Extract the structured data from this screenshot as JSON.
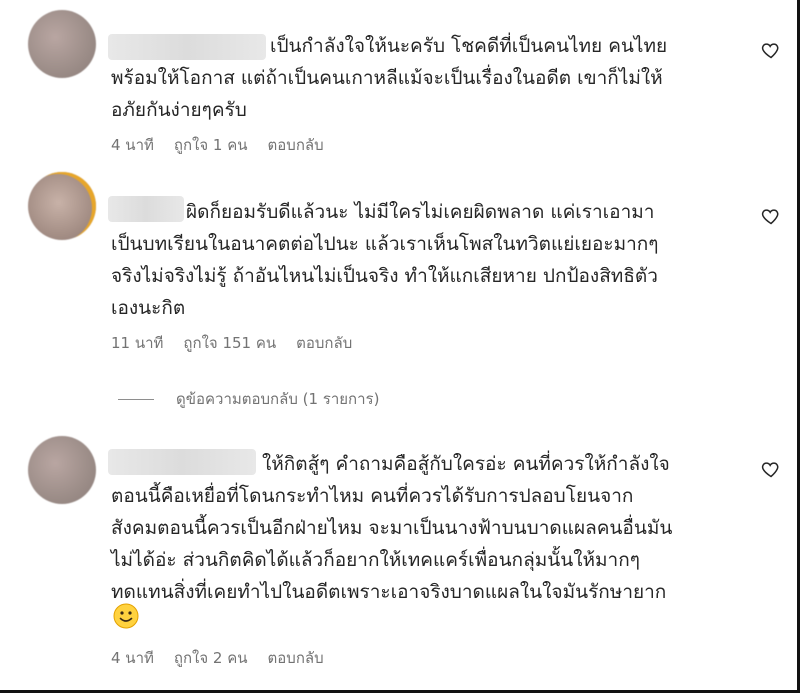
{
  "comments": [
    {
      "text_lines": [
        "เป็นกำลังใจให้นะครับ โชคดีที่เป็นคนไทย คนไทย",
        "พร้อมให้โอกาส แต่ถ้าเป็นคนเกาหลีแม้จะเป็นเรื่องในอดีต เขาก็ไม่ให้",
        "อภัยกันง่ายๆครับ"
      ],
      "time": "4 นาที",
      "likes": "ถูกใจ 1 คน",
      "reply": "ตอบกลับ"
    },
    {
      "text_lines": [
        "ผิดก็ยอมรับดีแล้วนะ ไม่มีใครไม่เคยผิดพลาด แค่เราเอามา",
        "เป็นบทเรียนในอนาคตต่อไปนะ แล้วเราเห็นโพสในทวิตแย่เยอะมากๆ",
        "จริงไม่จริงไม่รู้ ถ้าอันไหนไม่เป็นจริง ทำให้แกเสียหาย ปกป้องสิทธิตัว",
        "เองนะกิต"
      ],
      "time": "11 นาที",
      "likes": "ถูกใจ 151 คน",
      "reply": "ตอบกลับ",
      "view_replies": "ดูข้อความตอบกลับ (1 รายการ)"
    },
    {
      "text_lines": [
        "ให้กิตสู้ๆ คำถามคือสู้กับใครอ่ะ คนที่ควรให้กำลังใจ",
        "ตอนนี้คือเหยื่อที่โดนกระทำไหม คนที่ควรได้รับการปลอบโยนจาก",
        "สังคมตอนนี้ควรเป็นอีกฝ่ายไหม จะมาเป็นนางฟ้าบนบาดแผลคนอื่นมัน",
        "ไม่ได้อ่ะ ส่วนกิตคิดได้แล้วก็อยากให้เทคแคร์เพื่อนกลุ่มนั้นให้มากๆ",
        "ทดแทนสิ่งที่เคยทำไปในอดีตเพราะเอาจริงบาดแผลในใจมันรักษายาก"
      ],
      "emoji": "slightly-smiling-face",
      "time": "4 นาที",
      "likes": "ถูกใจ 2 คน",
      "reply": "ตอบกลับ"
    }
  ],
  "icons": {
    "like": "heart-outline-icon"
  }
}
